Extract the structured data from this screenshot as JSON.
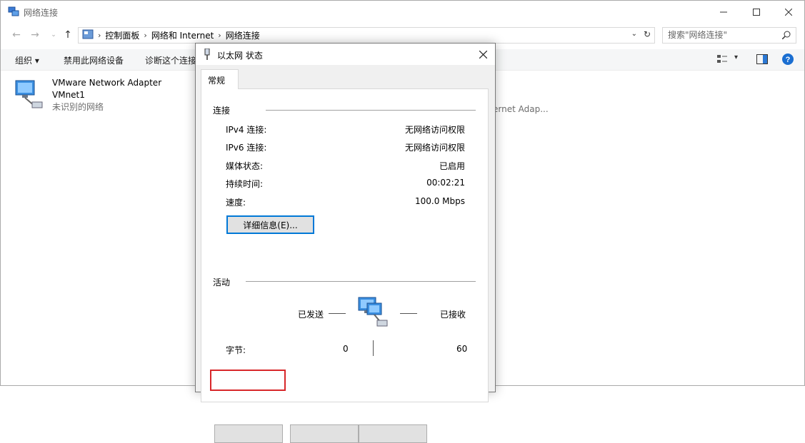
{
  "window": {
    "title": "网络连接"
  },
  "address": {
    "crumbs": [
      "控制面板",
      "网络和 Internet",
      "网络连接"
    ],
    "search_placeholder": "搜索\"网络连接\""
  },
  "toolbar": {
    "organize": "组织 ▾",
    "disable": "禁用此网络设备",
    "diagnose": "诊断这个连接"
  },
  "adapters": [
    {
      "name": "VMware Network Adapter",
      "name2": "VMnet1",
      "status": "未识别的网络"
    }
  ],
  "background_partial": "ernet Adap...",
  "dialog": {
    "title": "以太网 状态",
    "tab": "常规",
    "connection": {
      "header": "连接",
      "rows": [
        {
          "label": "IPv4 连接:",
          "value": "无网络访问权限"
        },
        {
          "label": "IPv6 连接:",
          "value": "无网络访问权限"
        },
        {
          "label": "媒体状态:",
          "value": "已启用"
        },
        {
          "label": "持续时间:",
          "value": "00:02:21"
        },
        {
          "label": "速度:",
          "value": "100.0 Mbps"
        }
      ],
      "details_button": "详细信息(E)..."
    },
    "activity": {
      "header": "活动",
      "sent_label": "已发送",
      "received_label": "已接收",
      "bytes_label": "字节:",
      "bytes_sent": "0",
      "bytes_received": "60"
    }
  },
  "colors": {
    "accent": "#0078d7",
    "highlight": "#d8272a"
  }
}
